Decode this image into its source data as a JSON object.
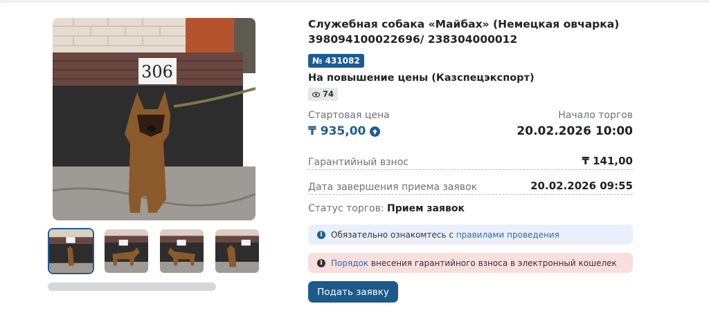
{
  "lot": {
    "title": "Служебная собака «Майбах» (Немецкая овчарка) 398094100022696/ 238304000012",
    "number_badge": "№ 431082",
    "subtitle": "На повышение цены (Казспецэкспорт)",
    "views": "74"
  },
  "gallery": {
    "photo_plate_number": "306",
    "thumbnails": 4
  },
  "pricing": {
    "start_price_label": "Стартовая цена",
    "start_price": "₸ 935,00",
    "auction_start_label": "Начало торгов",
    "auction_start": "20.02.2026 10:00",
    "guarantee_label": "Гарантийный взнос",
    "guarantee_value": "₸ 141,00",
    "deadline_label": "Дата завершения приема заявок",
    "deadline_value": "20.02.2026 09:55"
  },
  "status": {
    "label": "Статус торгов:",
    "value": "Прием заявок"
  },
  "notices": {
    "info_text": "Обязательно ознакомтесь с",
    "info_link": "правилами проведения",
    "warn_link": "Порядок",
    "warn_text": "внесения гарантийного взноса в электронный кошелек"
  },
  "actions": {
    "submit_label": "Подать заявку"
  },
  "colors": {
    "accent": "#1d5c92",
    "info_bg": "#eaf0fb",
    "warn_bg": "#f9dede"
  }
}
